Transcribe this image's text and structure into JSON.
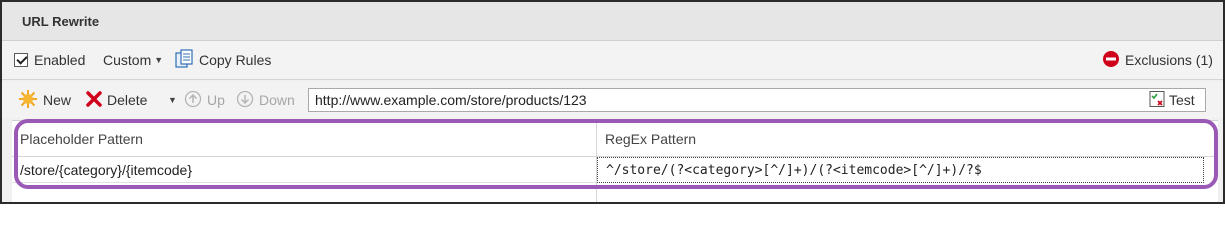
{
  "panel": {
    "title": "URL Rewrite"
  },
  "toolbar": {
    "enabled_label": "Enabled",
    "enabled_checked": true,
    "custom_label": "Custom",
    "copy_rules_label": "Copy Rules",
    "exclusions_label": "Exclusions (1)"
  },
  "actions": {
    "new_label": "New",
    "delete_label": "Delete",
    "up_label": "Up",
    "down_label": "Down",
    "test_url": "http://www.example.com/store/products/123",
    "test_label": "Test"
  },
  "grid": {
    "columns": [
      "Placeholder Pattern",
      "RegEx Pattern"
    ],
    "rows": [
      [
        "/store/{category}/{itemcode}",
        "^/store/(?<category>[^/]+)/(?<itemcode>[^/]+)/?$"
      ]
    ]
  },
  "colors": {
    "highlight": "#9b59b6",
    "new_icon": "#f5a623",
    "delete_icon": "#d0021b",
    "exclusions_icon": "#d0021b",
    "copy_icon": "#2f6fb5"
  },
  "icons": {
    "new": "sun-burst-icon",
    "delete": "red-x-icon",
    "up": "circle-up-arrow-icon",
    "down": "circle-down-arrow-icon",
    "copy": "copy-document-icon",
    "exclusions": "no-entry-icon",
    "test": "test-document-icon"
  }
}
